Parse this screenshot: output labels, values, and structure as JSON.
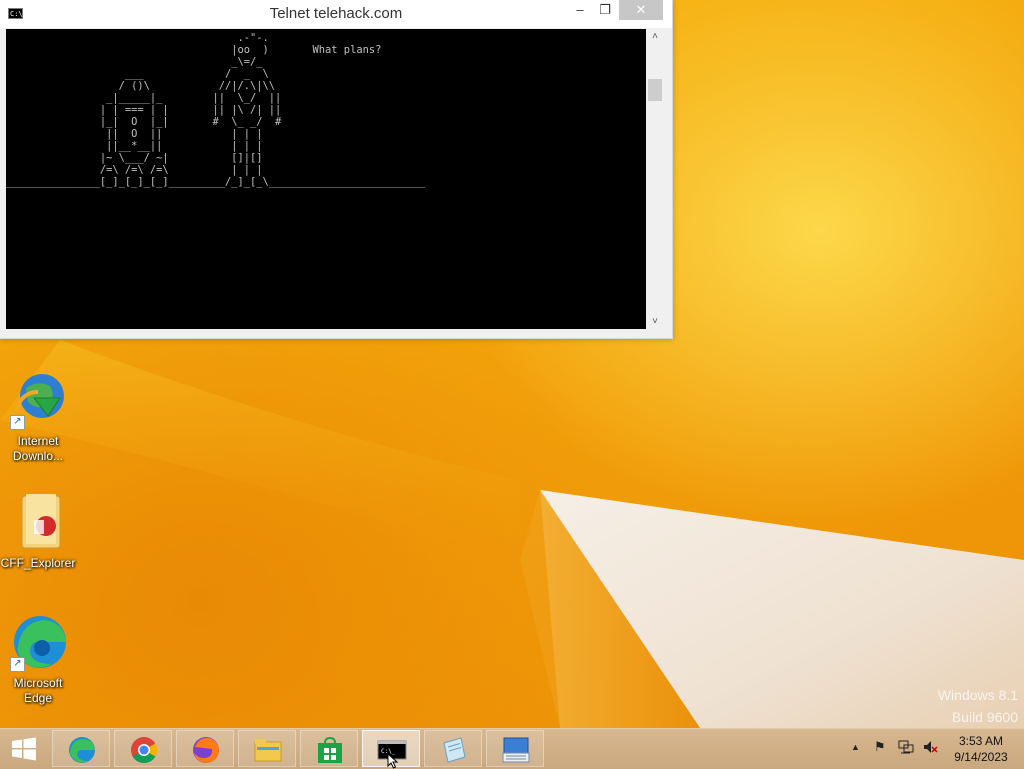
{
  "console": {
    "title": "Telnet telehack.com",
    "minimize": "–",
    "maximize": "❐",
    "close": "✕",
    "icon_text": "C:\\.",
    "output": "                                     .-\"-.\n                                    |oo  )       What plans?\n                                    _\\=/_\n                   ___             /  _  \\\n                  / ()\\           //|/.\\|\\\\\n                _|_____|_        ||  \\_/  ||\n               | | === | |       || |\\ /| ||\n               |_|  O  |_|       #  \\_ _/  #\n                ||  O  ||           | | |\n                ||__*__||           | | |\n               |~ \\___/ ~|          []|[]\n               /=\\ /=\\ /=\\          | | |\n_______________[_]_[_]_[_]_________/_]_[_\\_________________________"
  },
  "desktop_icons": [
    {
      "label_line1": "Internet",
      "label_line2": "Downlo...",
      "icon": "internet-download-manager-icon"
    },
    {
      "label_line1": "CFF_Explorer",
      "label_line2": "",
      "icon": "folder-icon"
    },
    {
      "label_line1": "Microsoft",
      "label_line2": "Edge",
      "icon": "edge-icon"
    }
  ],
  "watermark": {
    "line1": "Windows 8.1",
    "line2": "Build 9600"
  },
  "taskbar": {
    "apps": [
      {
        "name": "Microsoft Edge",
        "icon": "edge-icon"
      },
      {
        "name": "Google Chrome",
        "icon": "chrome-icon"
      },
      {
        "name": "Firefox",
        "icon": "firefox-icon"
      },
      {
        "name": "File Explorer",
        "icon": "file-explorer-icon"
      },
      {
        "name": "Store",
        "icon": "store-icon"
      },
      {
        "name": "Command Prompt",
        "icon": "cmd-icon",
        "active": true
      },
      {
        "name": "Notepad",
        "icon": "notepad-icon"
      },
      {
        "name": "On-Screen Keyboard",
        "icon": "keyboard-icon"
      }
    ],
    "tray": {
      "show_hidden": "▲",
      "flag": "⚑"
    },
    "clock": {
      "time": "3:53 AM",
      "date": "9/14/2023"
    }
  },
  "colors": {
    "wallpaper": "#f4a70c",
    "terminal_bg": "#000000",
    "terminal_fg": "#c0c0c0",
    "close_btn": "#c7c7c7"
  }
}
